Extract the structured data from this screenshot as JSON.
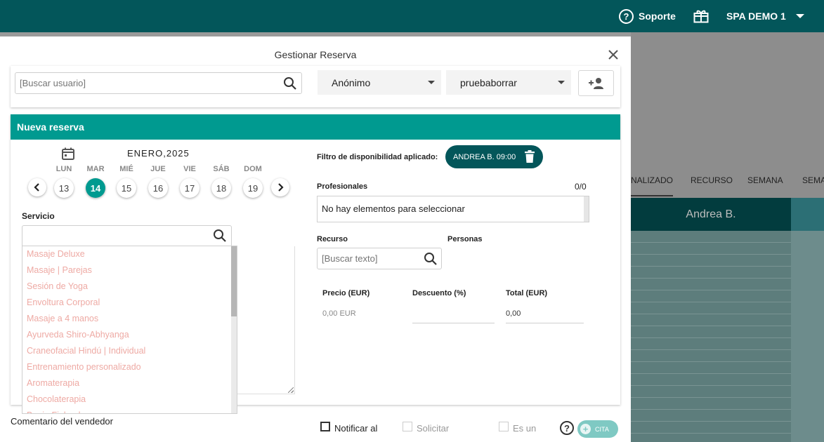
{
  "topbar": {
    "support_label": "Soporte",
    "account_label": "SPA DEMO 1"
  },
  "background": {
    "tabs": [
      {
        "label": "NALIZADO"
      },
      {
        "label": "RECURSO"
      },
      {
        "label": "SEMANA"
      },
      {
        "label": "SEMA"
      }
    ],
    "calendar_header": "Andrea B."
  },
  "modal": {
    "title": "Gestionar Reserva",
    "user_search_placeholder": "[Buscar usuario]",
    "client_select": "Anónimo",
    "second_select": "pruebaborrar",
    "card_title": "Nueva reserva",
    "month": "ENERO,2025",
    "days": [
      {
        "name": "LUN",
        "num": "13",
        "selected": false
      },
      {
        "name": "MAR",
        "num": "14",
        "selected": true
      },
      {
        "name": "MIÉ",
        "num": "15",
        "selected": false
      },
      {
        "name": "JUE",
        "num": "16",
        "selected": false
      },
      {
        "name": "VIE",
        "num": "17",
        "selected": false
      },
      {
        "name": "SÁB",
        "num": "18",
        "selected": false
      },
      {
        "name": "DOM",
        "num": "19",
        "selected": false
      }
    ],
    "servicio_label": "Servicio",
    "services": [
      "Masaje Deluxe",
      "Masaje | Parejas",
      "Sesión de Yoga",
      "Envoltura Corporal",
      "Masaje a 4 manos",
      "Ayurveda Shiro-Abhyanga",
      "Craneofacial Hindú | Individual",
      "Entrenamiento personalizado",
      "Aromaterapia",
      "Chocolaterapia",
      "Banio Finlandes"
    ],
    "filter_label": "Filtro de disponibilidad aplicado:",
    "filter_chip": "ANDREA B. 09:00",
    "professionals_label": "Profesionales",
    "professionals_count": "0/0",
    "professionals_empty": "No hay elementos para seleccionar",
    "recurso_label": "Recurso",
    "personas_label": "Personas",
    "recurso_placeholder": "[Buscar texto]",
    "price_label": "Precio (EUR)",
    "discount_label": "Descuento (%)",
    "total_label": "Total (EUR)",
    "price_value": "0,00 EUR",
    "total_value": "0,00",
    "seller_comment_label": "Comentario del vendedor",
    "notify_label": "Notificar al",
    "request_label": "Solicitar",
    "is_one_label": "Es un",
    "cita_label": "CITA"
  }
}
